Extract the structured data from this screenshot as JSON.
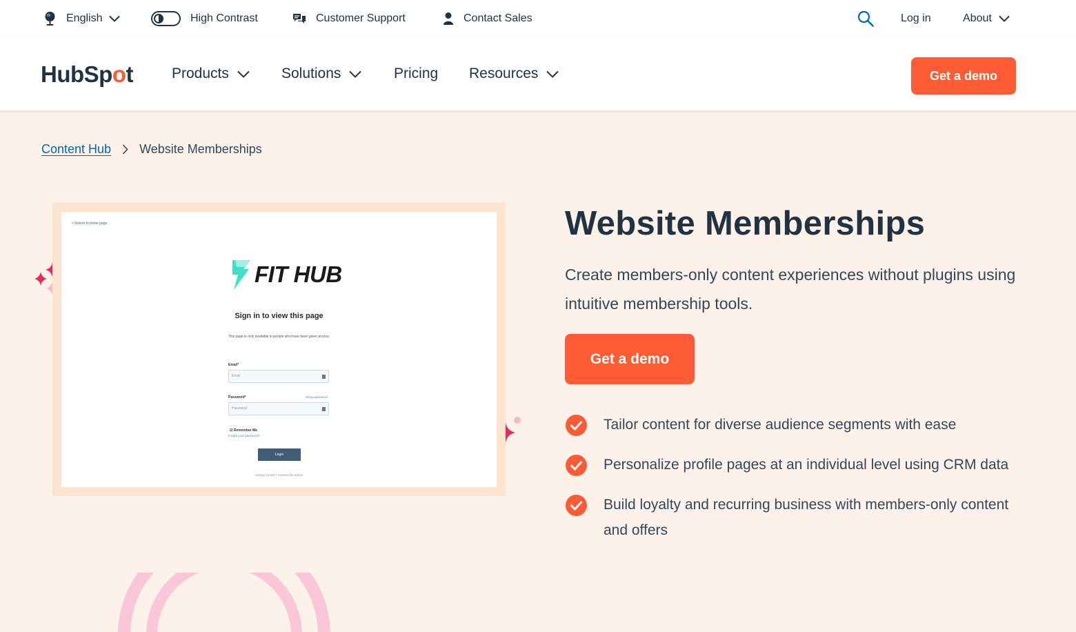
{
  "utility_bar": {
    "language": "English",
    "high_contrast": "High Contrast",
    "customer_support": "Customer Support",
    "contact_sales": "Contact Sales",
    "log_in": "Log in",
    "about": "About"
  },
  "nav": {
    "logo": {
      "before": "HubSp",
      "o": "o",
      "after": "t"
    },
    "items": [
      "Products",
      "Solutions",
      "Pricing",
      "Resources"
    ],
    "cta": "Get a demo"
  },
  "breadcrumb": {
    "parent": "Content Hub",
    "current": "Website Memberships"
  },
  "preview": {
    "return_link": "< Return to home page",
    "brand": "FIT HUB",
    "title": "Sign in to view this page",
    "subtitle": "This page is only available to people who have been given access.",
    "email_label": "Email*",
    "email_placeholder": "Email",
    "password_label": "Password*",
    "show_password": "Show password",
    "password_placeholder": "Password",
    "remember_me": "Remember Me",
    "forgot": "Forgot your password?",
    "login": "Login",
    "trouble": "Having trouble? Contact the admin"
  },
  "hero": {
    "title": "Website Memberships",
    "description": "Create members-only content experiences without plugins using intuitive membership tools.",
    "cta": "Get a demo",
    "features": [
      "Tailor content for diverse audience segments with ease",
      "Personalize profile pages at an individual level using CRM data",
      "Build loyalty and recurring business with members-only content and offers"
    ]
  },
  "colors": {
    "accent": "#ff5c35",
    "text": "#213343",
    "link": "#0068b1",
    "background": "#fdf2ea",
    "sparkle": "#e8285a"
  },
  "icons": [
    "globe-icon",
    "toggle-icon",
    "chat-icon",
    "person-icon",
    "search-icon",
    "chevron-down-icon",
    "chevron-right-icon",
    "check-circle-icon",
    "sparkle-icon"
  ]
}
